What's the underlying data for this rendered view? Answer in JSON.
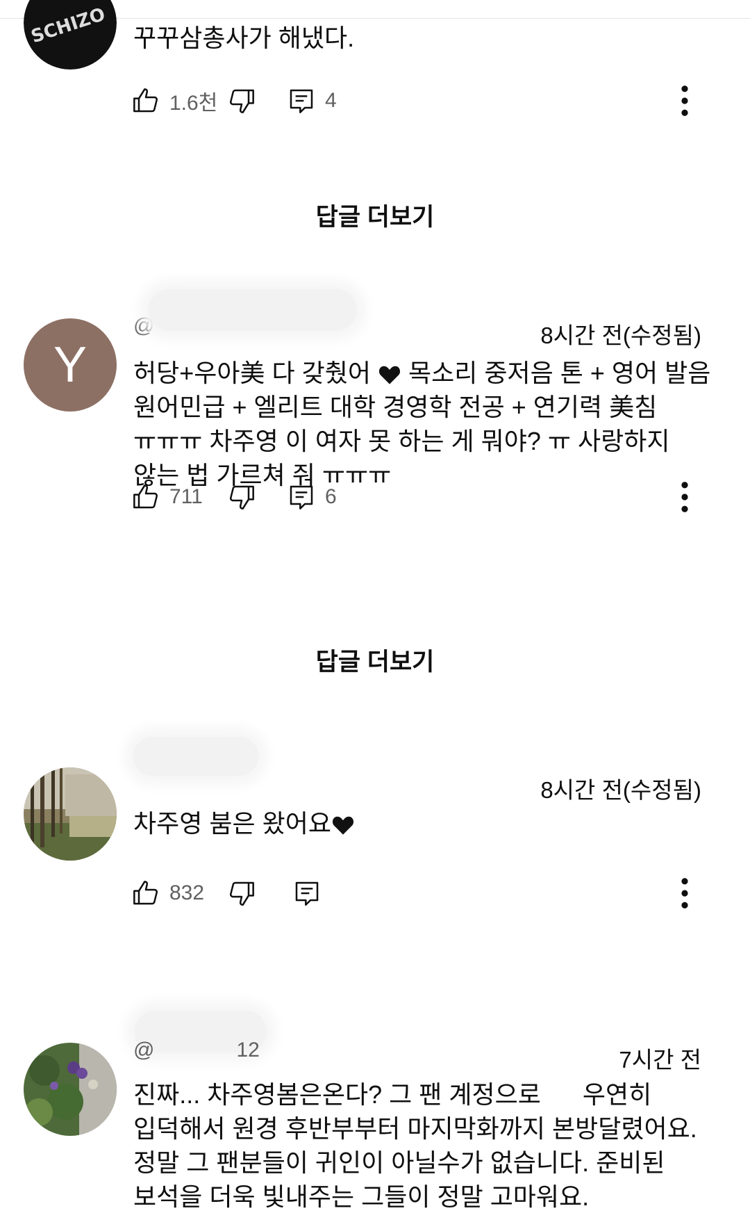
{
  "comments": [
    {
      "text": "꾸꾸삼총사가 해냈다.",
      "likes": "1.6천",
      "replies": "4",
      "avatar": "schizophonic-logo-avatar"
    },
    {
      "avatar_letter": "Y",
      "handle": "@",
      "timestamp": "8시간 전(수정됨)",
      "text_parts": [
        "허당+우아美 다 갖췄어 ",
        " 목소리 중저음 톤 + 영어 발음 원어민급 + 엘리트 대학 경영학 전공 + 연기력 美침 ㅠㅠㅠ 차주영 이 여자 못 하는 게 뭐야? ㅠ 사랑하지 않는 법 가르쳐 줘 ㅠㅠㅠ"
      ],
      "likes": "711",
      "replies": "6"
    },
    {
      "timestamp": "8시간 전(수정됨)",
      "text": "차주영 붐은 왔어요",
      "likes": "832",
      "avatar": "forest-photo-avatar"
    },
    {
      "handle": "@",
      "handle_suffix": "12",
      "timestamp": "7시간 전",
      "text": "진짜... 차주영봄은온다? 그 팬 계정으로      우연히 입덕해서 원경 후반부부터 마지막화까지 본방달렸어요. 정말 그 팬분들이 귀인이 아닐수가 없습니다. 준비된 보석을 더욱 빛내주는 그들이 정말 고마워요.",
      "avatar": "flower-photo-avatar"
    }
  ],
  "more_replies_label": "답글 더보기",
  "icons": [
    "like-icon",
    "dislike-icon",
    "reply-icon",
    "more-vert-icon",
    "heart-emoji"
  ],
  "colors": {
    "text": "#0f0f0f",
    "secondary": "#606060",
    "avatar_y": "#8d7064"
  }
}
